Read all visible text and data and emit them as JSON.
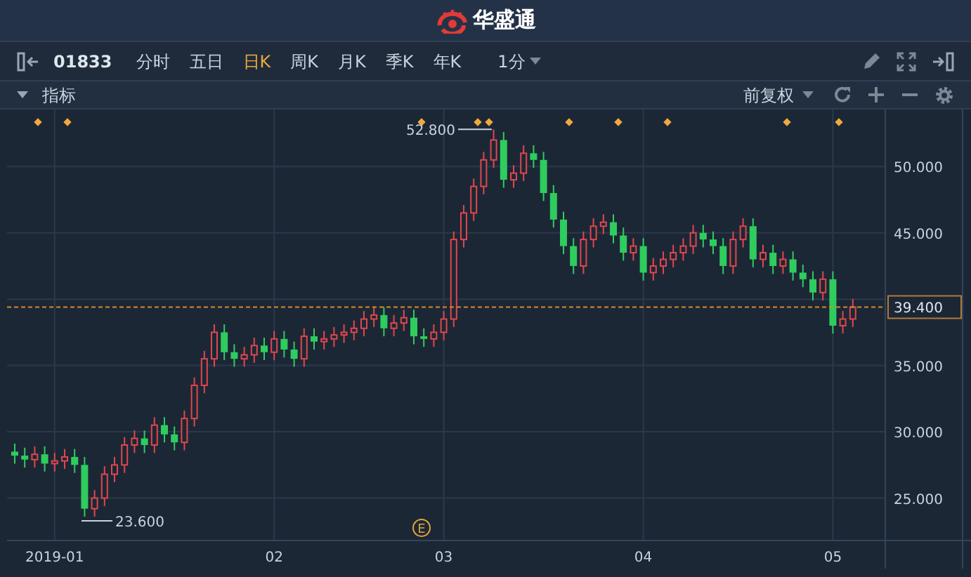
{
  "header": {
    "logo_text": "华盛通"
  },
  "toolbar": {
    "symbol": "01833",
    "periods": [
      {
        "label": "分时",
        "selected": false
      },
      {
        "label": "五日",
        "selected": false
      },
      {
        "label": "日K",
        "selected": true
      },
      {
        "label": "周K",
        "selected": false
      },
      {
        "label": "月K",
        "selected": false
      },
      {
        "label": "季K",
        "selected": false
      },
      {
        "label": "年K",
        "selected": false
      }
    ],
    "interval": "1分"
  },
  "subbar": {
    "indicator_label": "指标",
    "adjustment": "前复权"
  },
  "chart": {
    "high_label": "52.800",
    "low_label": "23.600",
    "last_price": "39.400",
    "event_badge": "E",
    "chart_data": {
      "type": "candlestick",
      "categories": [
        null,
        null,
        null,
        null,
        "2019-01",
        null,
        null,
        null,
        null,
        null,
        null,
        null,
        null,
        null,
        null,
        null,
        null,
        null,
        null,
        null,
        null,
        null,
        null,
        null,
        null,
        null,
        "02",
        null,
        null,
        null,
        null,
        null,
        null,
        null,
        null,
        null,
        null,
        null,
        null,
        null,
        null,
        null,
        null,
        "03",
        null,
        null,
        null,
        null,
        null,
        null,
        null,
        null,
        null,
        null,
        null,
        null,
        null,
        null,
        null,
        null,
        null,
        null,
        null,
        "04",
        null,
        null,
        null,
        null,
        null,
        null,
        null,
        null,
        null,
        null,
        null,
        null,
        null,
        null,
        null,
        null,
        null,
        null,
        "05",
        null,
        null
      ],
      "ylim": [
        21.8,
        54.3
      ],
      "grid": true,
      "ref_lines": [
        {
          "axis": "y",
          "value": 39.4,
          "color": "#d88a2a"
        }
      ],
      "ohlc": [
        [
          28.5,
          29.1,
          27.6,
          28.2
        ],
        [
          28.2,
          28.8,
          27.3,
          27.9
        ],
        [
          27.9,
          28.9,
          27.3,
          28.3
        ],
        [
          28.3,
          28.9,
          27.0,
          27.6
        ],
        [
          27.6,
          28.4,
          27.0,
          27.8
        ],
        [
          27.8,
          28.7,
          27.2,
          28.1
        ],
        [
          28.1,
          28.7,
          26.9,
          27.5
        ],
        [
          27.5,
          28.1,
          23.6,
          24.2
        ],
        [
          24.2,
          25.6,
          23.6,
          25.0
        ],
        [
          25.0,
          27.4,
          24.4,
          26.8
        ],
        [
          26.8,
          28.1,
          26.2,
          27.5
        ],
        [
          27.5,
          29.6,
          26.9,
          29.0
        ],
        [
          29.0,
          30.1,
          28.4,
          29.5
        ],
        [
          29.5,
          30.1,
          28.4,
          29.0
        ],
        [
          29.0,
          31.1,
          28.4,
          30.5
        ],
        [
          30.5,
          31.1,
          29.2,
          29.8
        ],
        [
          29.8,
          30.4,
          28.6,
          29.2
        ],
        [
          29.2,
          31.6,
          28.6,
          31.0
        ],
        [
          31.0,
          34.1,
          30.4,
          33.5
        ],
        [
          33.5,
          36.1,
          32.9,
          35.5
        ],
        [
          35.5,
          38.1,
          34.9,
          37.5
        ],
        [
          37.5,
          38.1,
          35.4,
          36.0
        ],
        [
          36.0,
          36.6,
          34.9,
          35.5
        ],
        [
          35.5,
          36.4,
          34.9,
          35.8
        ],
        [
          35.8,
          37.1,
          35.2,
          36.5
        ],
        [
          36.5,
          37.1,
          35.4,
          36.0
        ],
        [
          36.0,
          37.6,
          35.4,
          37.0
        ],
        [
          37.0,
          37.6,
          35.6,
          36.2
        ],
        [
          36.2,
          36.8,
          34.9,
          35.5
        ],
        [
          35.5,
          37.8,
          34.9,
          37.2
        ],
        [
          37.2,
          37.8,
          36.2,
          36.8
        ],
        [
          36.8,
          37.6,
          36.2,
          37.0
        ],
        [
          37.0,
          37.9,
          36.4,
          37.3
        ],
        [
          37.3,
          38.1,
          36.7,
          37.5
        ],
        [
          37.5,
          38.4,
          36.9,
          37.8
        ],
        [
          37.8,
          39.1,
          37.2,
          38.5
        ],
        [
          38.5,
          39.4,
          37.9,
          38.8
        ],
        [
          38.8,
          39.4,
          37.2,
          37.8
        ],
        [
          37.8,
          38.8,
          37.2,
          38.2
        ],
        [
          38.2,
          39.2,
          37.6,
          38.6
        ],
        [
          38.6,
          39.2,
          36.6,
          37.2
        ],
        [
          37.2,
          37.8,
          36.4,
          37.0
        ],
        [
          37.0,
          38.1,
          36.4,
          37.5
        ],
        [
          37.5,
          39.1,
          36.9,
          38.5
        ],
        [
          38.5,
          45.1,
          37.9,
          44.5
        ],
        [
          44.5,
          47.1,
          43.9,
          46.5
        ],
        [
          46.5,
          49.1,
          45.9,
          48.5
        ],
        [
          48.5,
          51.1,
          47.9,
          50.5
        ],
        [
          50.5,
          52.8,
          49.9,
          52.0
        ],
        [
          52.0,
          52.6,
          48.4,
          49.0
        ],
        [
          49.0,
          50.1,
          48.4,
          49.5
        ],
        [
          49.5,
          51.6,
          48.9,
          51.0
        ],
        [
          51.0,
          51.6,
          49.9,
          50.5
        ],
        [
          50.5,
          51.1,
          47.4,
          48.0
        ],
        [
          48.0,
          48.6,
          45.4,
          46.0
        ],
        [
          46.0,
          46.6,
          43.4,
          44.0
        ],
        [
          44.0,
          44.6,
          41.9,
          42.5
        ],
        [
          42.5,
          45.1,
          41.9,
          44.5
        ],
        [
          44.5,
          46.1,
          43.9,
          45.5
        ],
        [
          45.5,
          46.4,
          44.9,
          45.8
        ],
        [
          45.8,
          46.4,
          44.2,
          44.8
        ],
        [
          44.8,
          45.4,
          42.9,
          43.5
        ],
        [
          43.5,
          44.6,
          42.9,
          44.0
        ],
        [
          44.0,
          44.6,
          41.4,
          42.0
        ],
        [
          42.0,
          43.1,
          41.4,
          42.5
        ],
        [
          42.5,
          43.6,
          41.9,
          43.0
        ],
        [
          43.0,
          44.1,
          42.4,
          43.5
        ],
        [
          43.5,
          44.6,
          42.9,
          44.0
        ],
        [
          44.0,
          45.6,
          43.4,
          45.0
        ],
        [
          45.0,
          45.6,
          43.9,
          44.5
        ],
        [
          44.5,
          45.1,
          43.4,
          44.0
        ],
        [
          44.0,
          44.6,
          41.9,
          42.5
        ],
        [
          42.5,
          45.1,
          41.9,
          44.5
        ],
        [
          44.5,
          46.1,
          43.9,
          45.5
        ],
        [
          45.5,
          46.1,
          42.4,
          43.0
        ],
        [
          43.0,
          44.1,
          42.4,
          43.5
        ],
        [
          43.5,
          44.1,
          41.9,
          42.5
        ],
        [
          42.5,
          43.6,
          41.9,
          43.0
        ],
        [
          43.0,
          43.6,
          41.4,
          42.0
        ],
        [
          42.0,
          42.6,
          40.9,
          41.5
        ],
        [
          41.5,
          42.1,
          39.9,
          40.5
        ],
        [
          40.5,
          42.1,
          39.9,
          41.5
        ],
        [
          41.5,
          42.1,
          37.4,
          38.0
        ],
        [
          38.0,
          39.1,
          37.4,
          38.5
        ],
        [
          38.5,
          40.0,
          37.9,
          39.4
        ]
      ],
      "yticks": [
        {
          "value": 50,
          "label": "50.000"
        },
        {
          "value": 45,
          "label": "45.000"
        },
        {
          "value": 35,
          "label": "35.000"
        },
        {
          "value": 30,
          "label": "30.000"
        },
        {
          "value": 25,
          "label": "25.000"
        }
      ]
    }
  }
}
